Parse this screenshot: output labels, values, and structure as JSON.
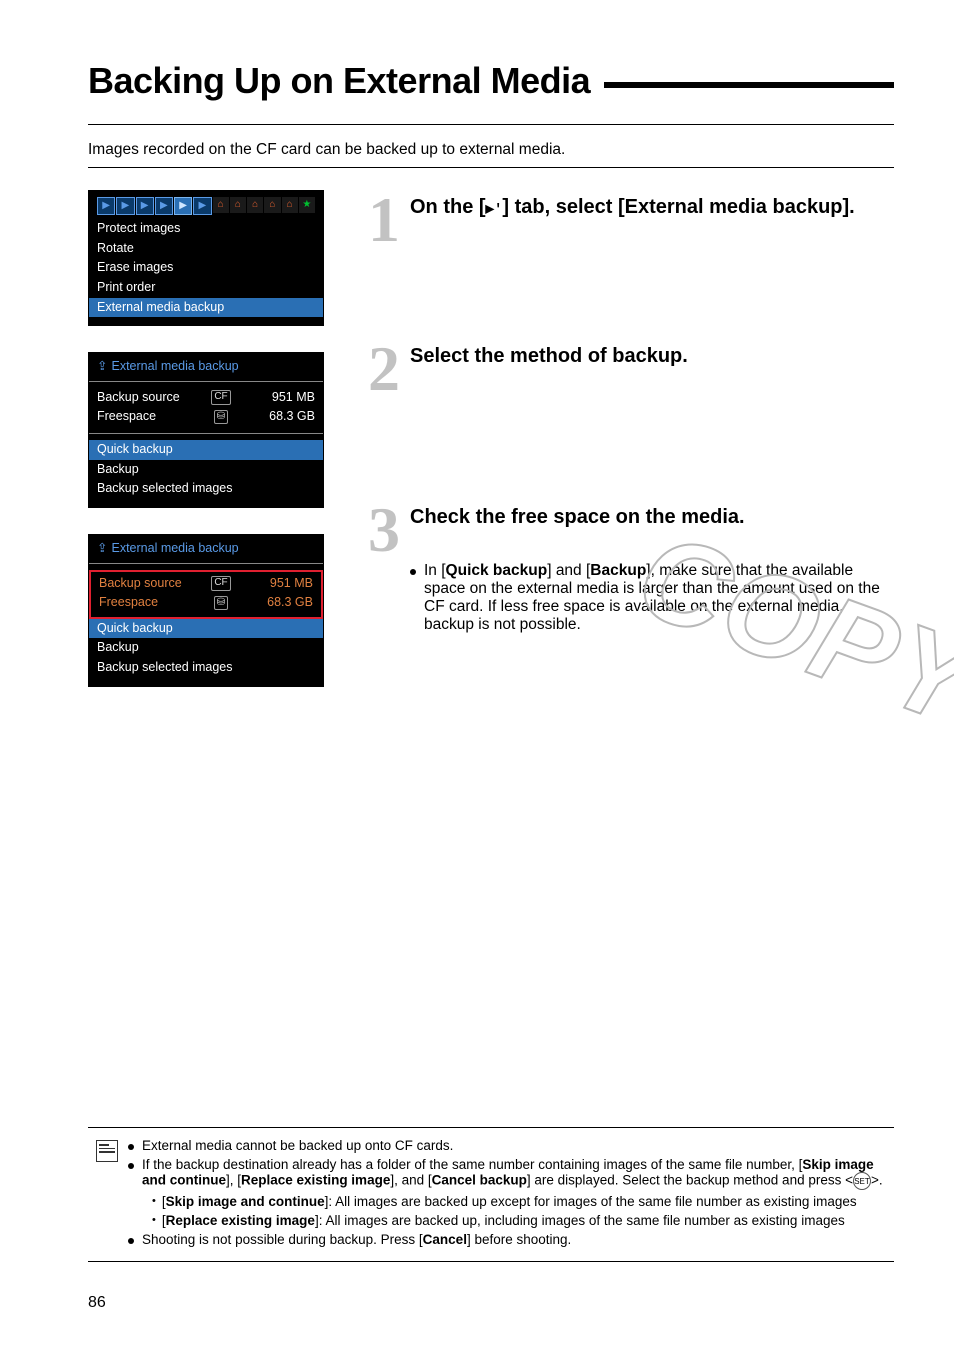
{
  "title": "Backing Up on External Media",
  "intro": "Images recorded on the CF card can be backed up to external media.",
  "page_num": "86",
  "watermark": "COPY",
  "screens": {
    "a": {
      "menu": [
        "Protect images",
        "Rotate",
        "Erase images",
        "Print order",
        "External media backup"
      ],
      "highlight_index": 4
    },
    "b": {
      "header": "External media backup",
      "rows": [
        {
          "label": "Backup source",
          "mid_icon": "CF",
          "value": "951 MB"
        },
        {
          "label": "Freespace",
          "mid_icon": "disk",
          "value": "68.3 GB"
        }
      ],
      "options": [
        "Quick backup",
        "Backup",
        "Backup selected images"
      ],
      "highlight_option": 0
    },
    "c": {
      "header": "External media backup",
      "rows": [
        {
          "label": "Backup source",
          "mid_icon": "CF",
          "value": "951 MB",
          "orange": true
        },
        {
          "label": "Freespace",
          "mid_icon": "disk",
          "value": "68.3 GB",
          "orange": true
        }
      ],
      "options": [
        "Quick backup",
        "Backup",
        "Backup selected images"
      ],
      "highlight_option": 0,
      "boxed_rows": true
    }
  },
  "steps": {
    "s1": {
      "num": "1",
      "title_pre": "On the [",
      "title_tab_glyph": "▶'",
      "title_post": "] tab, select [External media backup]."
    },
    "s2": {
      "num": "2",
      "title": "Select the method of backup."
    },
    "s3": {
      "num": "3",
      "title": "Check the free space on the media.",
      "body_pre": "In [",
      "body_b1": "Quick backup",
      "body_mid1": "] and [",
      "body_b2": "Backup",
      "body_post": "], make sure that the available space on the external media is larger than the amount used on the CF card. If less free space is available on the external media, backup is not possible."
    }
  },
  "notes": {
    "n1": "External media cannot be backed up onto CF cards.",
    "n2_pre": "If the backup destination already has a folder of the same number containing images of the same file number, [",
    "n2_b1": "Skip image and continue",
    "n2_mid1": "], [",
    "n2_b2": "Replace existing image",
    "n2_mid2": "], and [",
    "n2_b3": "Cancel backup",
    "n2_post1": "] are displayed. Select the backup method and press <",
    "n2_set": "SET",
    "n2_post2": ">.",
    "n2a_pre": "[",
    "n2a_b": "Skip image and continue",
    "n2a_post": "]: All images are backed up except for images of the same file number as existing images",
    "n2b_pre": "[",
    "n2b_b": "Replace existing image",
    "n2b_post": "]: All images are backed up, including images of the same file number as existing images",
    "n3_pre": "Shooting is not possible during backup. Press [",
    "n3_b": "Cancel",
    "n3_post": "] before shooting."
  }
}
